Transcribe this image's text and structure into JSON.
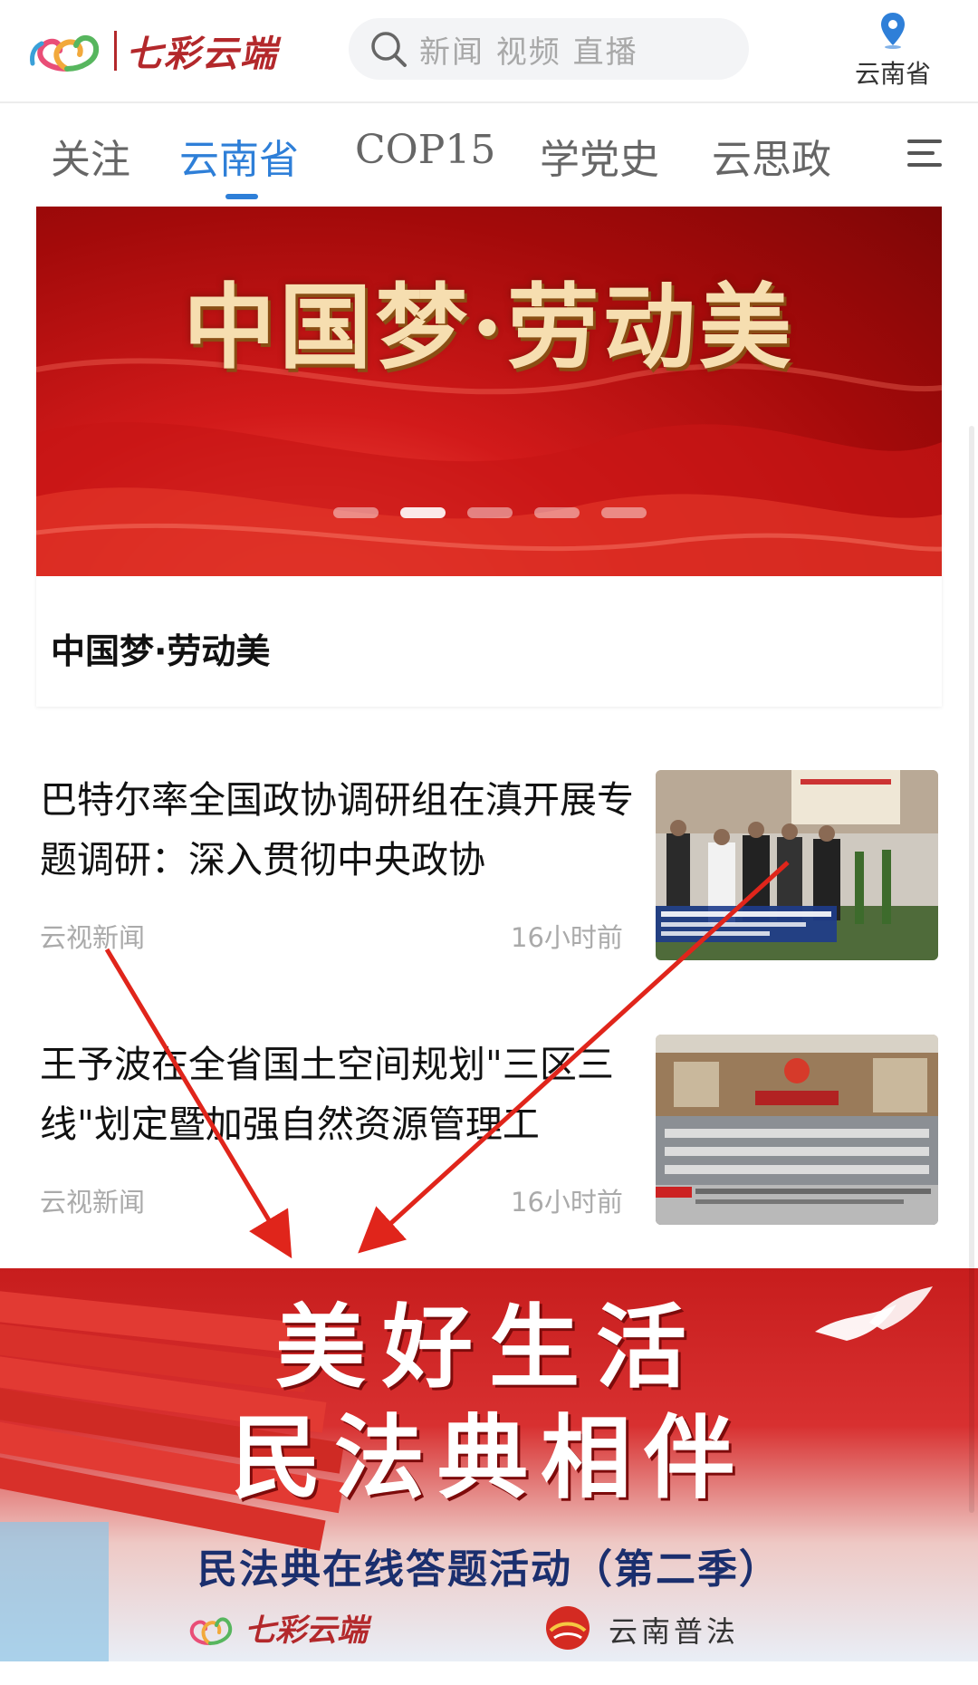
{
  "header": {
    "logo_text": "七彩云端",
    "search_placeholder": "新闻 视频 直播",
    "location_label": "云南省"
  },
  "tabs": [
    {
      "label": "关注",
      "active": false
    },
    {
      "label": "云南省",
      "active": true
    },
    {
      "label": "COP15",
      "active": false
    },
    {
      "label": "学党史",
      "active": false
    },
    {
      "label": "云思政",
      "active": false
    }
  ],
  "banner": {
    "headline": "中国梦·劳动美",
    "caption": "中国梦·劳动美",
    "slide_count": 5,
    "active_slide": 2
  },
  "news": [
    {
      "title": "巴特尔率全国政协调研组在滇开展专题调研：深入贯彻中央政协",
      "source": "云视新闻",
      "time": "16小时前"
    },
    {
      "title": "王予波在全省国土空间规划\"三区三线\"划定暨加强自然资源管理工",
      "source": "云视新闻",
      "time": "16小时前"
    }
  ],
  "promo": {
    "line1": "美好生活",
    "line2": "民法典相伴",
    "subtitle": "民法典在线答题活动（第二季）",
    "brand1": "七彩云端",
    "brand2": "云南普法"
  },
  "colors": {
    "accent": "#2e7fd8",
    "brand_red": "#b3282b",
    "annotation_arrow": "#e0251b"
  },
  "icons": {
    "search": "search-icon",
    "location": "location-pin-icon",
    "menu": "hamburger-menu-icon"
  }
}
